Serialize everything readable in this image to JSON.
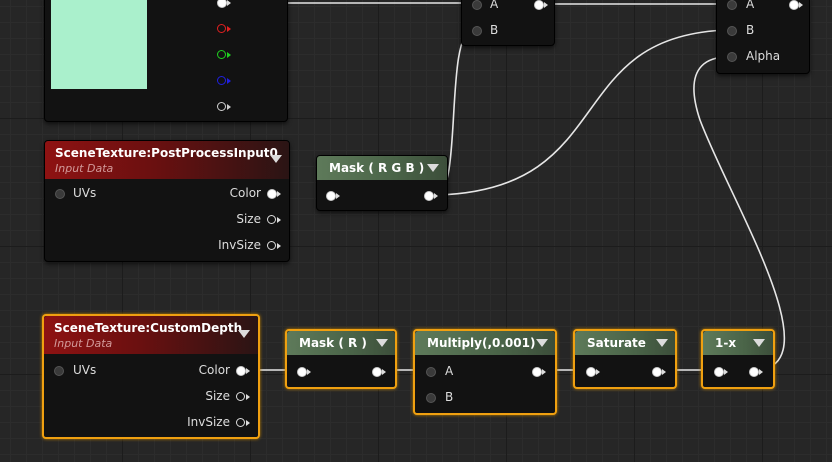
{
  "nodes": {
    "pp": {
      "title": "SceneTexture:PostProcessInput0",
      "subtitle": "Input Data",
      "uvs": "UVs",
      "color": "Color",
      "size": "Size",
      "invsize": "InvSize"
    },
    "cd": {
      "title": "SceneTexture:CustomDepth",
      "subtitle": "Input Data",
      "uvs": "UVs",
      "color": "Color",
      "size": "Size",
      "invsize": "InvSize"
    },
    "mask_rgb": {
      "title": "Mask ( R G B )"
    },
    "mask_r": {
      "title": "Mask ( R )"
    },
    "multiply": {
      "title": "Multiply(,0.001)",
      "a": "A",
      "b": "B"
    },
    "saturate": {
      "title": "Saturate"
    },
    "oneminus": {
      "title": "1-x"
    },
    "lerp_top": {
      "a": "A",
      "b": "B"
    },
    "lerp_right": {
      "a": "A",
      "b": "B",
      "alpha": "Alpha"
    }
  },
  "colors": {
    "preview": "#aaf0cc",
    "selection": "#f0a010",
    "wire": "#e6e6e6"
  }
}
